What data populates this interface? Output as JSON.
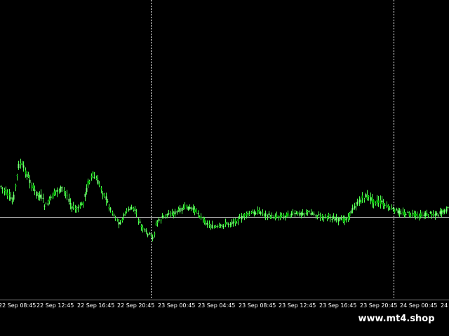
{
  "chart_data": {
    "type": "candlestick",
    "colors": {
      "background": "#000000",
      "bull": "#00c000",
      "bear": "#7cff7c",
      "wick": "#4cff4c",
      "grid": "#ffffff",
      "price_line": "#b0b0b0",
      "axis_text": "#ffffff"
    },
    "time_labels": [
      "22 Sep 08:45",
      "22 Sep 12:45",
      "22 Sep 16:45",
      "22 Sep 20:45",
      "23 Sep 00:45",
      "23 Sep 04:45",
      "23 Sep 08:45",
      "23 Sep 12:45",
      "23 Sep 16:45",
      "23 Sep 20:45",
      "24 Sep 00:45",
      "24"
    ],
    "day_separators": [
      "23 Sep 00:00",
      "24 Sep 00:00"
    ]
  },
  "watermark": {
    "text": "www.mt4.shop"
  }
}
